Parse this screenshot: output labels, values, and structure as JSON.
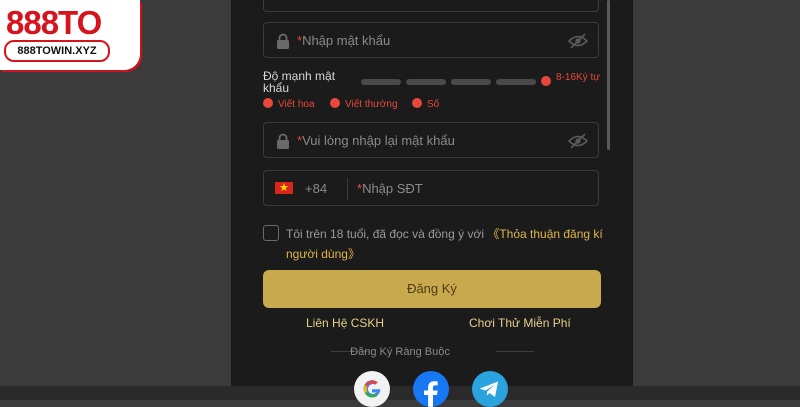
{
  "logo": {
    "brand": "888TO",
    "domain": "888TOWIN.XYZ"
  },
  "form": {
    "password": {
      "required_mark": "*",
      "placeholder": "Nhập mật khẩu",
      "icon": "lock-icon",
      "toggle_icon": "eye-slash-icon"
    },
    "strength": {
      "label": "Độ mạnh mật khẩu",
      "bars": 4,
      "length_hint": "8-16Ký tự",
      "rules": [
        "Viết hoa",
        "Viết thường",
        "Số"
      ]
    },
    "confirm_password": {
      "required_mark": "*",
      "placeholder": "Vui lòng nhập lại mật khẩu"
    },
    "phone": {
      "country_code": "+84",
      "required_mark": "*",
      "placeholder": "Nhập SĐT",
      "flag": "vietnam-flag-icon"
    },
    "terms": {
      "text": "Tôi trên 18 tuổi, đã đọc và đồng ý với ",
      "link": "《Thỏa thuận đăng kí người dùng》"
    },
    "register_label": "Đăng Ký",
    "contact_label": "Liên Hệ CSKH",
    "trial_label": "Chơi Thử Miễn Phí",
    "bind_title": "Đăng Ký Ràng Buộc"
  },
  "socials": [
    "google-icon",
    "facebook-icon",
    "telegram-icon"
  ],
  "colors": {
    "accent": "#c9a94e",
    "error": "#e8473c",
    "panel": "#1b1b1b",
    "page": "#3b3b3b"
  }
}
